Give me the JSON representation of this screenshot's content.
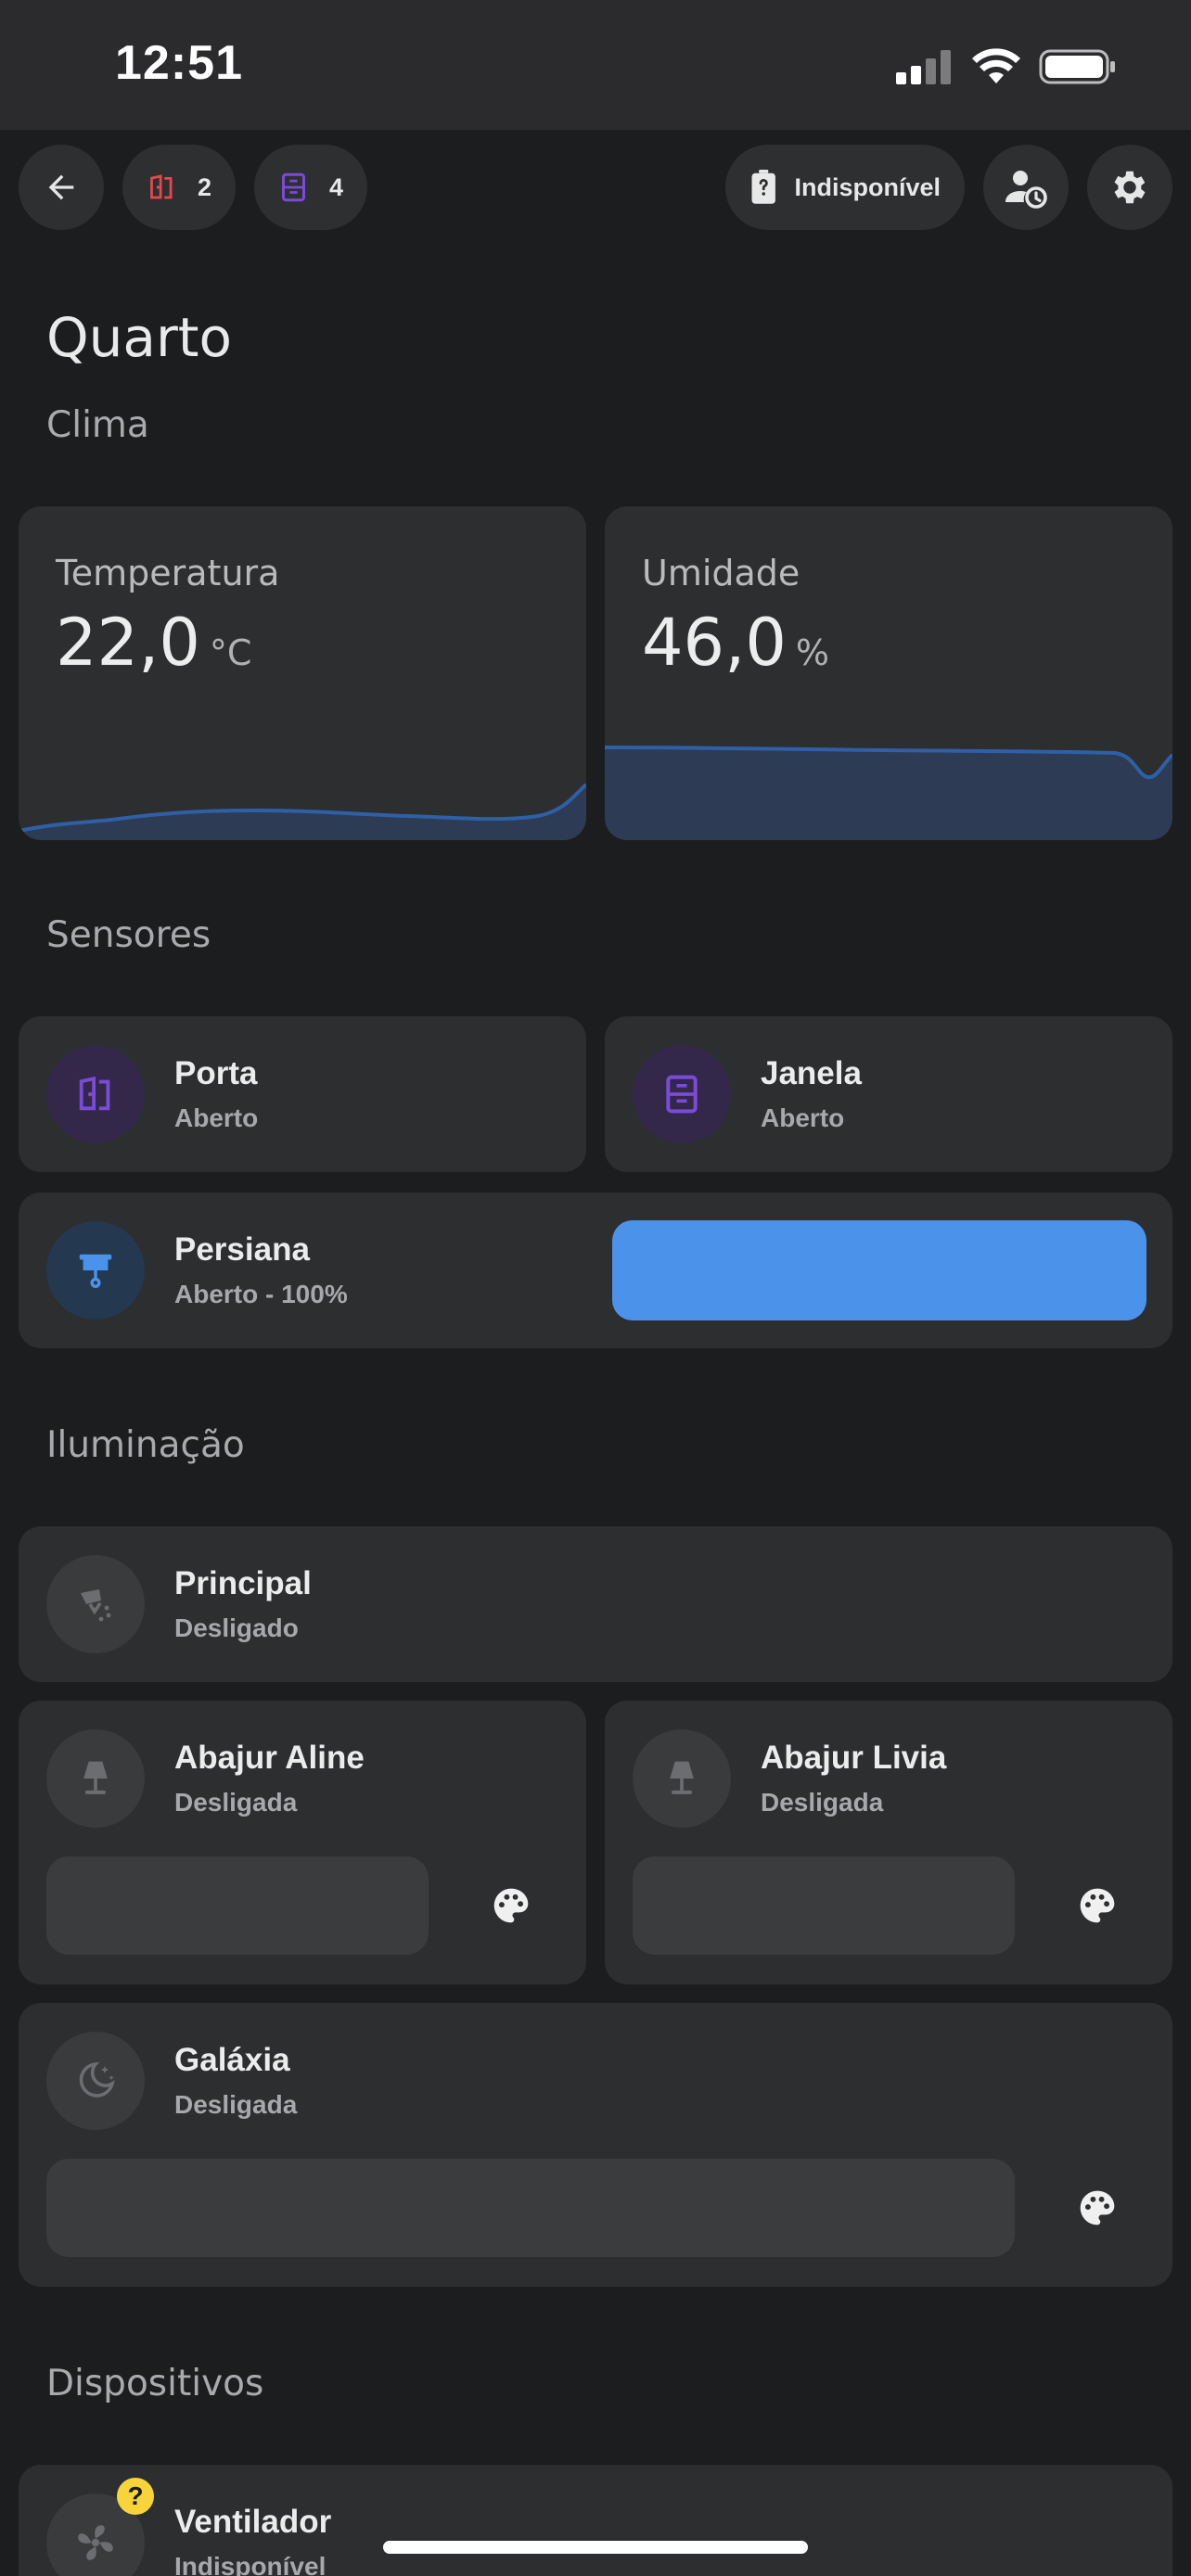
{
  "status_bar": {
    "time": "12:51"
  },
  "header": {
    "door_count": "2",
    "window_count": "4",
    "battery_chip": "Indisponível"
  },
  "room": {
    "title": "Quarto"
  },
  "sections": {
    "climate": "Clima",
    "sensors": "Sensores",
    "lighting": "Iluminação",
    "devices": "Dispositivos"
  },
  "climate": {
    "temperature": {
      "label": "Temperatura",
      "value": "22,0",
      "unit": "°C"
    },
    "humidity": {
      "label": "Umidade",
      "value": "46,0",
      "unit": "%"
    }
  },
  "sensors": {
    "door": {
      "name": "Porta",
      "state": "Aberto"
    },
    "window": {
      "name": "Janela",
      "state": "Aberto"
    },
    "blind": {
      "name": "Persiana",
      "state": "Aberto - 100%",
      "position_percent": 100
    }
  },
  "lighting": {
    "main": {
      "name": "Principal",
      "state": "Desligado"
    },
    "lamp_aline": {
      "name": "Abajur Aline",
      "state": "Desligada"
    },
    "lamp_livia": {
      "name": "Abajur Livia",
      "state": "Desligada"
    },
    "galaxy": {
      "name": "Galáxia",
      "state": "Desligada"
    }
  },
  "devices": {
    "fan": {
      "name": "Ventilador",
      "state": "Indisponível",
      "badge": "?"
    }
  },
  "colors": {
    "background": "#1c1d1f",
    "card": "#2d2e30",
    "accent_blue": "#4b93ea",
    "door_red": "#e5484d",
    "purple": "#7a4bd6",
    "badge_yellow": "#f7d53a"
  }
}
